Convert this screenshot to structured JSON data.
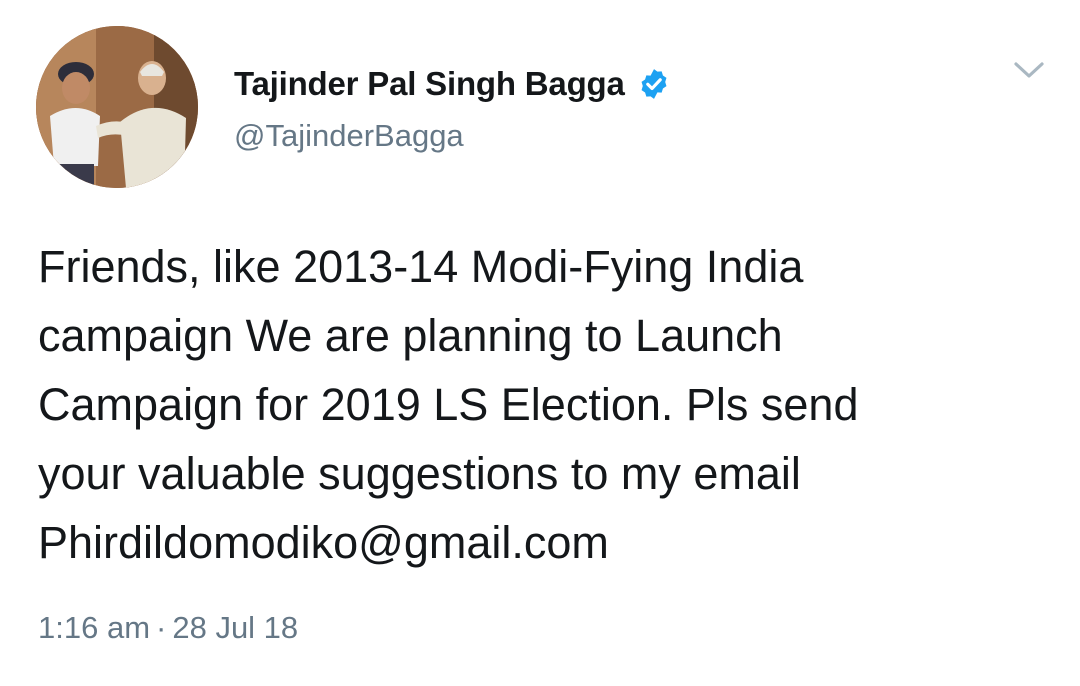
{
  "tweet": {
    "author": {
      "display_name": "Tajinder Pal Singh Bagga",
      "handle": "@TajinderBagga",
      "verified": true,
      "verified_icon": "verified-badge-icon",
      "avatar_icon": "profile-photo"
    },
    "text": "Friends, like 2013-14 Modi-Fying India\ncampaign We are planning to Launch\nCampaign for 2019 LS Election. Pls send\nyour valuable suggestions to my email\nPhirdildomodiko@gmail.com",
    "time": "1:16 am",
    "separator": "·",
    "date": "28 Jul 18",
    "menu_icon": "chevron-down-icon"
  },
  "colors": {
    "text_primary": "#14171a",
    "text_secondary": "#657786",
    "verified_blue": "#1da1f2",
    "chevron": "#aab8c2"
  }
}
